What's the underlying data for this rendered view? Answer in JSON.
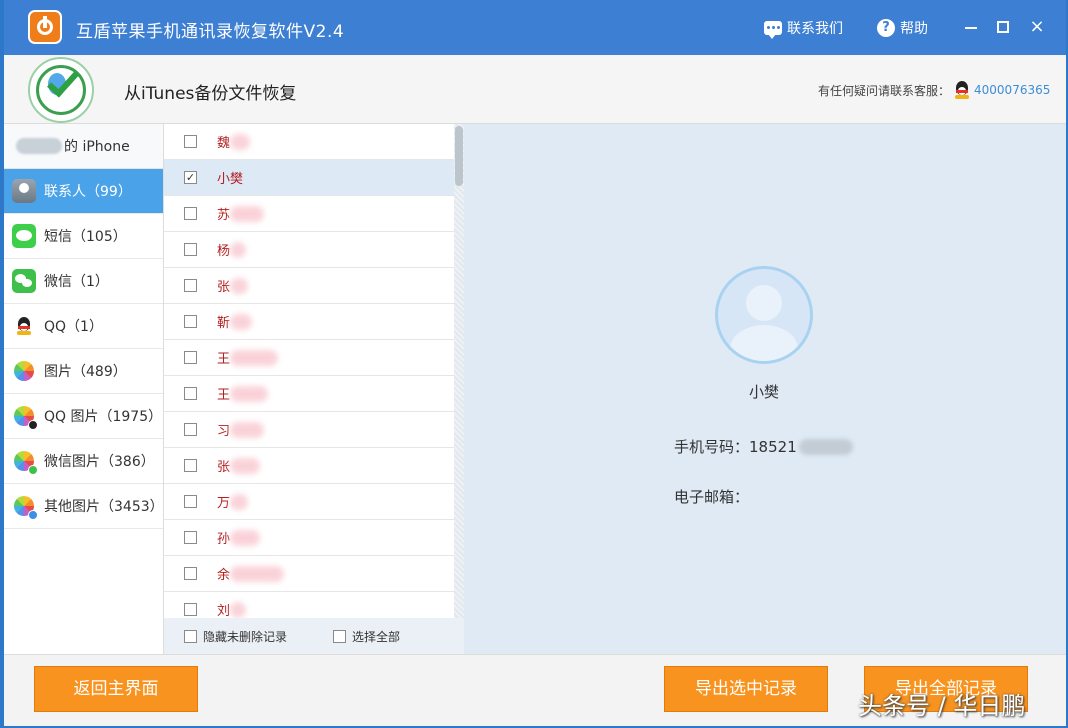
{
  "window": {
    "title": "互盾苹果手机通讯录恢复软件V2.4",
    "contact_label": "联系我们",
    "help_label": "帮助",
    "minimize": "minimize",
    "maximize": "maximize",
    "close": "×"
  },
  "header": {
    "heading": "从iTunes备份文件恢复",
    "support_label": "有任何疑问请联系客服：",
    "support_number": "4000076365"
  },
  "sidebar": {
    "device_suffix": "的 iPhone",
    "items": [
      {
        "label": "联系人（99）",
        "icon": "contacts-icon"
      },
      {
        "label": "短信（105）",
        "icon": "messages-icon"
      },
      {
        "label": "微信（1）",
        "icon": "wechat-icon"
      },
      {
        "label": "QQ（1）",
        "icon": "qq-icon"
      },
      {
        "label": "图片（489）",
        "icon": "photos-icon"
      },
      {
        "label": "QQ 图片（1975）",
        "icon": "qq-photos-icon"
      },
      {
        "label": "微信图片（386）",
        "icon": "wechat-photos-icon"
      },
      {
        "label": "其他图片（3453）",
        "icon": "other-photos-icon"
      }
    ]
  },
  "contacts": {
    "rows": [
      {
        "name": "魏",
        "checked": false
      },
      {
        "name": "小樊",
        "checked": true
      },
      {
        "name": "苏",
        "checked": false
      },
      {
        "name": "杨",
        "checked": false
      },
      {
        "name": "张",
        "checked": false
      },
      {
        "name": "靳",
        "checked": false
      },
      {
        "name": "王",
        "checked": false
      },
      {
        "name": "王",
        "checked": false
      },
      {
        "name": "习",
        "checked": false
      },
      {
        "name": "张",
        "checked": false
      },
      {
        "name": "万",
        "checked": false
      },
      {
        "name": "孙",
        "checked": false
      },
      {
        "name": "余",
        "checked": false
      },
      {
        "name": "刘",
        "checked": false
      }
    ],
    "hide_undeleted_label": "隐藏未删除记录",
    "select_all_label": "选择全部"
  },
  "detail": {
    "name": "小樊",
    "phone_label": "手机号码：",
    "phone_value": "18521",
    "email_label": "电子邮箱：",
    "email_value": ""
  },
  "footer": {
    "back_label": "返回主界面",
    "export_selected_label": "导出选中记录",
    "export_all_label": "导出全部记录",
    "watermark": "头条号 / 华日鹏"
  },
  "colors": {
    "titlebar": "#3d7fd2",
    "sidebar_active": "#4aa3e8",
    "button": "#f7931e",
    "detail_bg": "#dfeaf5",
    "contact_name": "#b31d1d",
    "support_number": "#3c8ed6"
  }
}
